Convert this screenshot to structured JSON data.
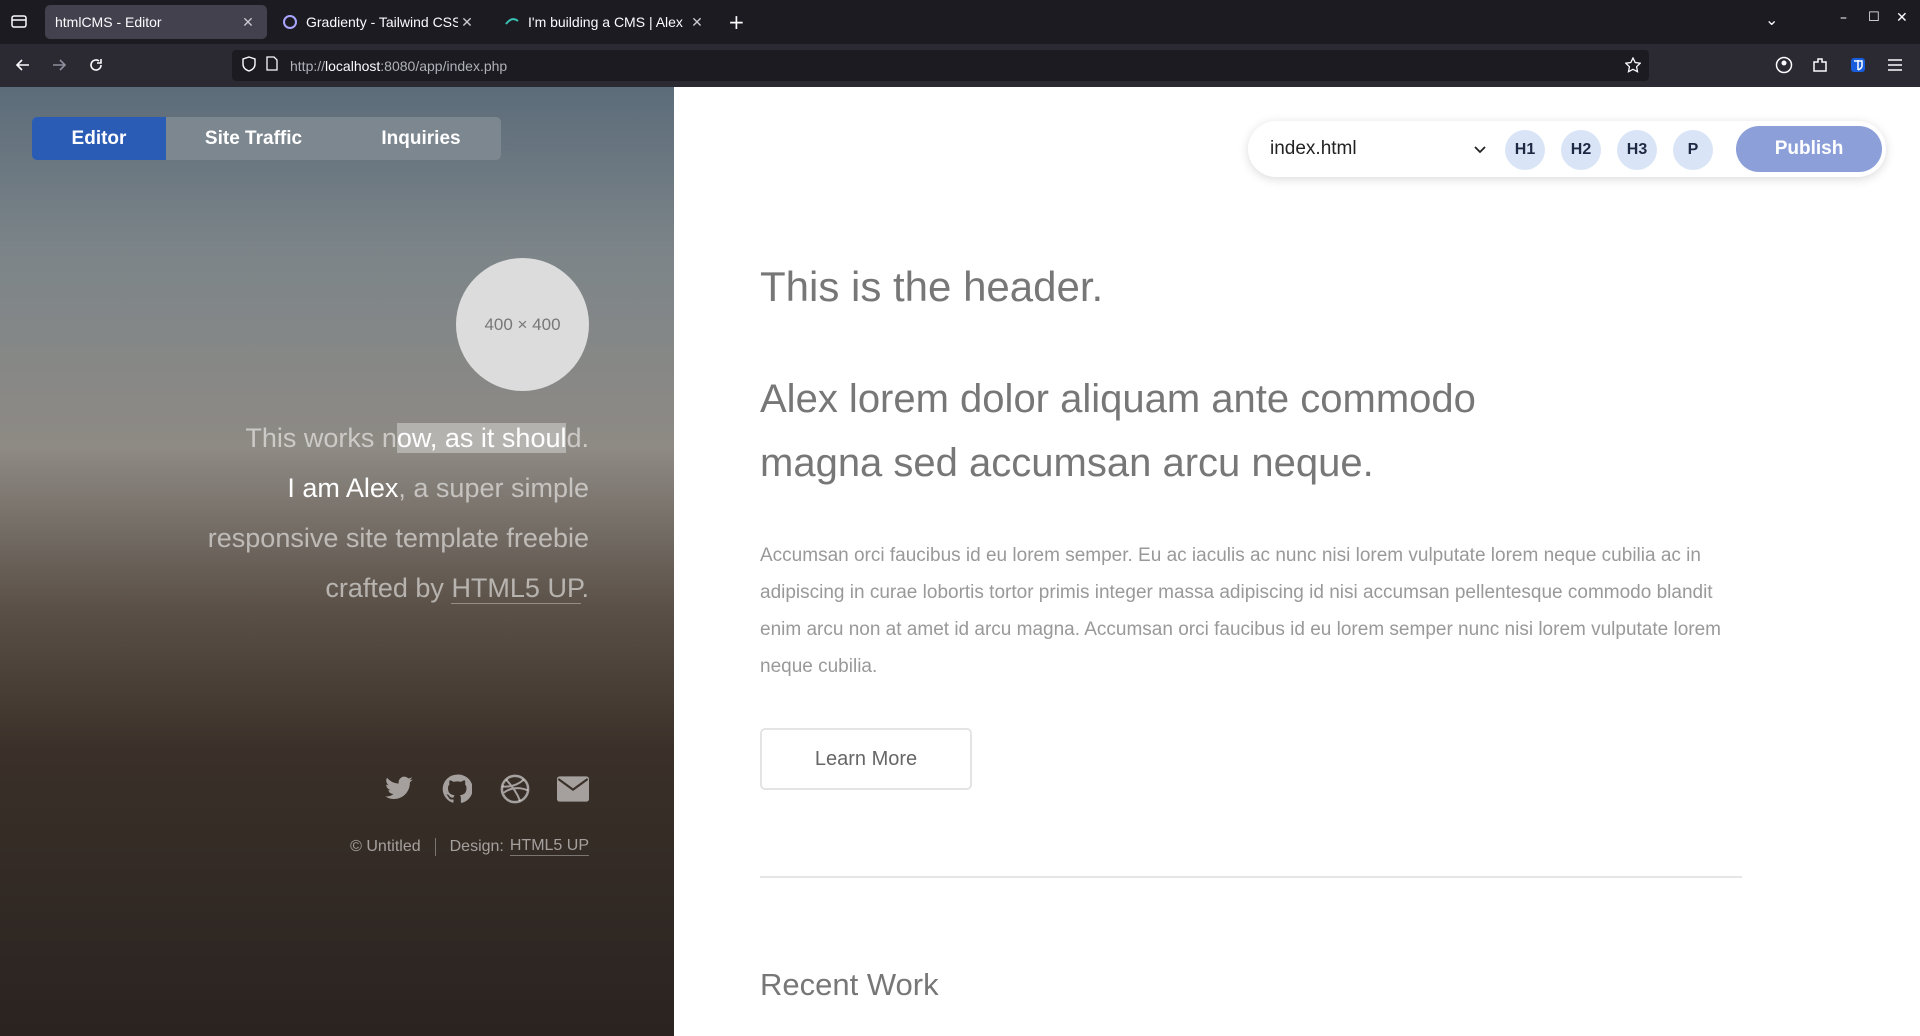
{
  "browser": {
    "tabs": [
      {
        "title": "htmlCMS - Editor",
        "active": true
      },
      {
        "title": "Gradienty - Tailwind CSS B",
        "active": false
      },
      {
        "title": "I'm building a CMS | Alex",
        "active": false
      }
    ],
    "url_prefix": "http://",
    "url_host": "localhost",
    "url_rest": ":8080/app/index.php"
  },
  "sidebar": {
    "tabs": [
      "Editor",
      "Site Traffic",
      "Inquiries"
    ],
    "avatar_text": "400 × 400",
    "bio": {
      "line1_a": "This works n",
      "line1_sel": "ow, as it shoul",
      "line1_b": "d.",
      "name": "I am Alex",
      "rest1": ", a super simple",
      "rest2": "responsive site template freebie",
      "rest3_pre": "crafted by ",
      "link": "HTML5 UP",
      "rest3_post": "."
    },
    "social_icons": [
      "twitter-icon",
      "github-icon",
      "dribbble-icon",
      "mail-icon"
    ],
    "footer": {
      "copyright": "© Untitled",
      "design_label": "Design:",
      "design_link": "HTML5 UP"
    }
  },
  "toolbar": {
    "file": "index.html",
    "buttons": [
      "H1",
      "H2",
      "H3",
      "P"
    ],
    "publish": "Publish"
  },
  "content": {
    "header": "This is the header.",
    "subheader": "Alex lorem dolor aliquam ante commodo magna sed accumsan arcu neque.",
    "paragraph": "Accumsan orci faucibus id eu lorem semper. Eu ac iaculis ac nunc nisi lorem vulputate lorem neque cubilia ac in adipiscing in curae lobortis tortor primis integer massa adipiscing id nisi accumsan pellentesque commodo blandit enim arcu non at amet id arcu magna. Accumsan orci faucibus id eu lorem semper nunc nisi lorem vulputate lorem neque cubilia.",
    "button": "Learn More",
    "recent": "Recent Work"
  }
}
